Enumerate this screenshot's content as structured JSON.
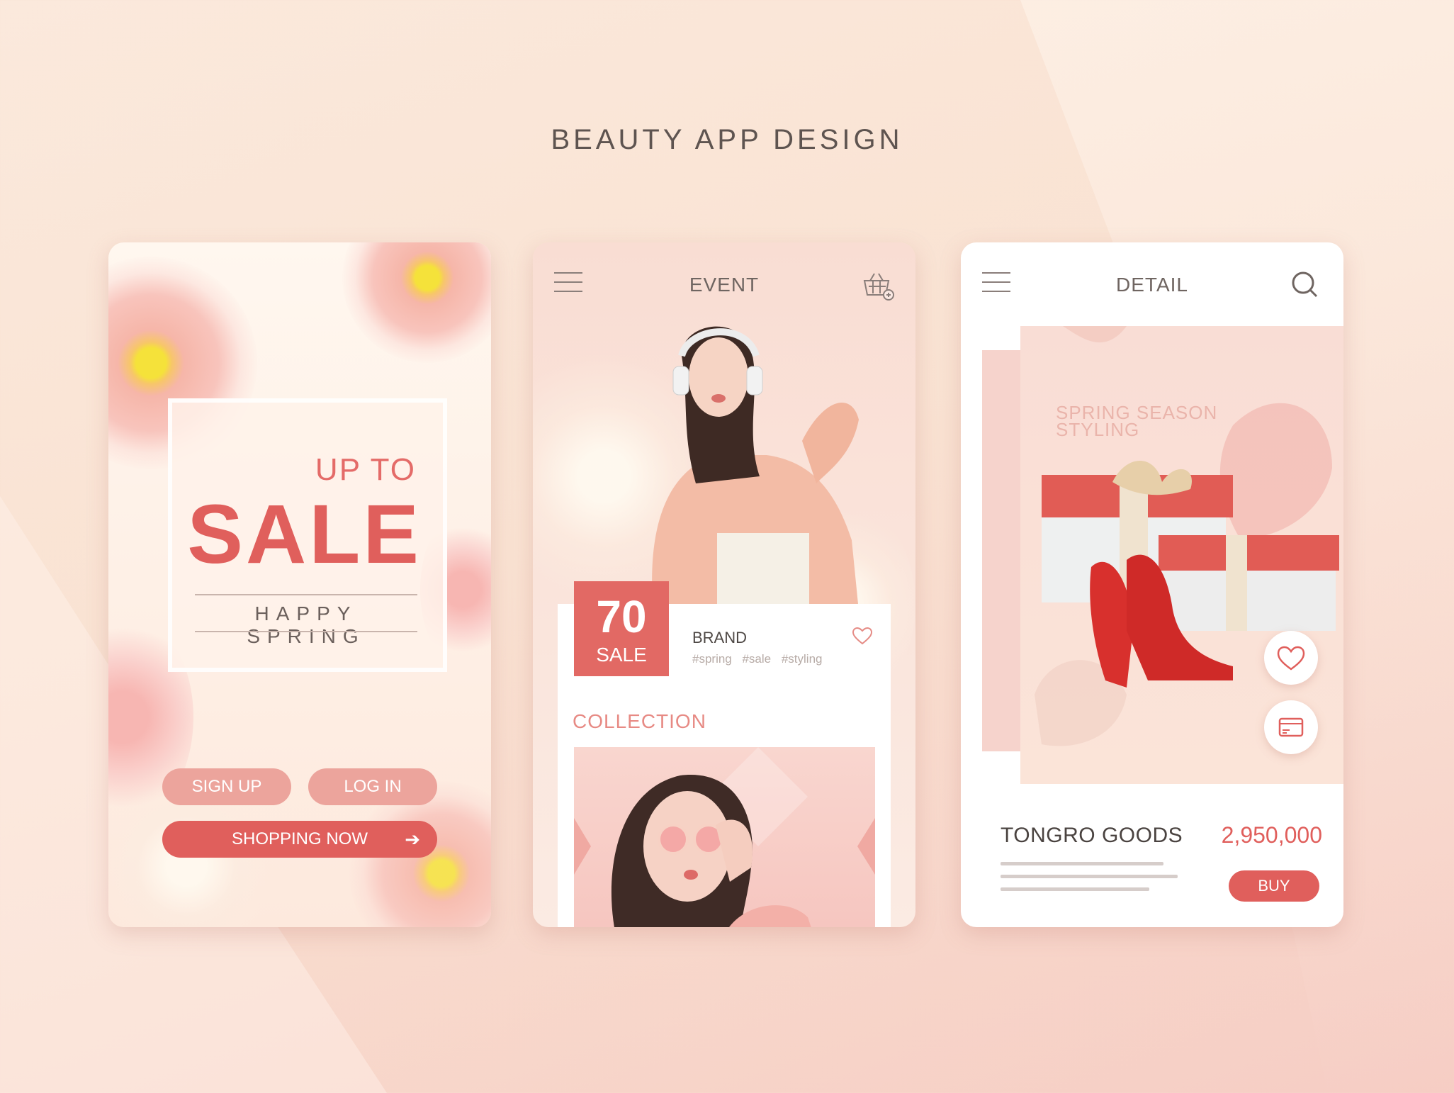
{
  "header": {
    "title": "BEAUTY APP DESIGN"
  },
  "screen1": {
    "up_to": "UP TO",
    "sale": "SALE",
    "tagline": "HAPPY SPRING",
    "signup_label": "SIGN UP",
    "login_label": "LOG IN",
    "shopping_label": "SHOPPING NOW"
  },
  "screen2": {
    "title": "EVENT",
    "badge_number": "70",
    "badge_text": "SALE",
    "brand": "BRAND",
    "tags": "#spring #sale #styling",
    "collection_label": "COLLECTION"
  },
  "screen3": {
    "title": "DETAIL",
    "banner_text_1": "SPRING SEASON",
    "banner_text_2": "STYLING",
    "product_name": "TONGRO GOODS",
    "price": "2,950,000",
    "buy_label": "BUY"
  },
  "colors": {
    "accent": "#e05f5c",
    "light_accent": "#eca49c",
    "background": "#fbe9dc"
  },
  "icons": [
    "menu-icon",
    "shopping-basket-icon",
    "heart-icon",
    "search-icon",
    "card-icon",
    "arrow-right-icon"
  ]
}
